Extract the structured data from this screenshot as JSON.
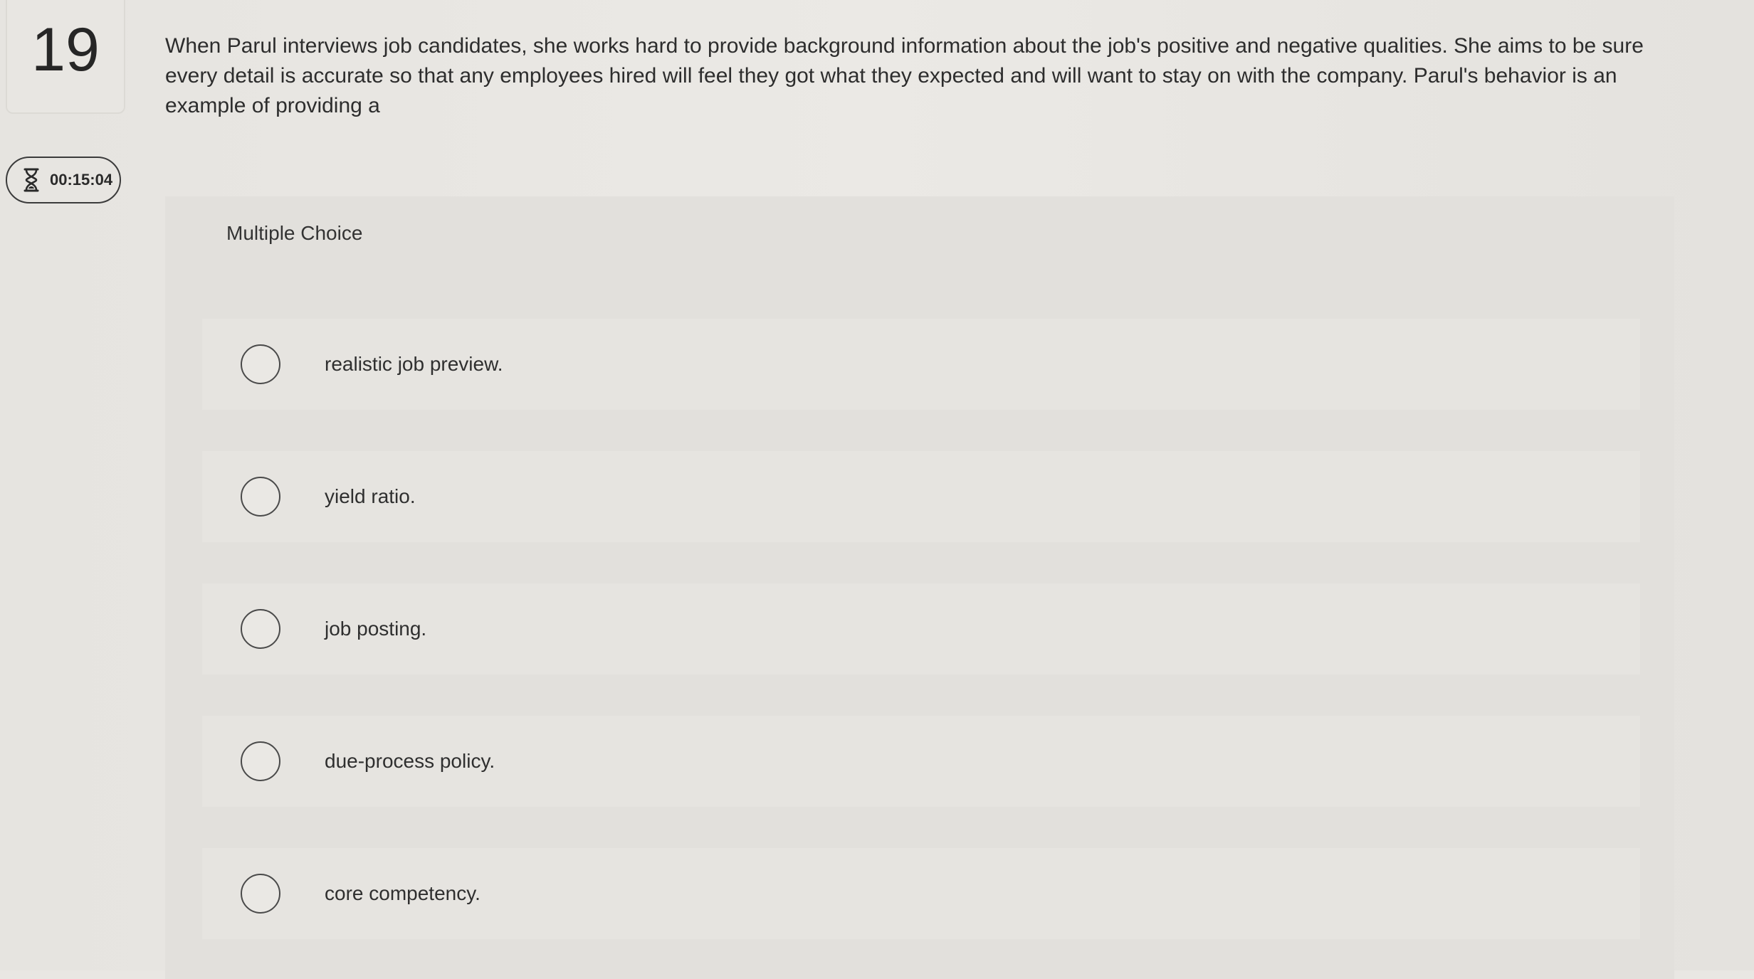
{
  "question": {
    "number": "19",
    "text": "When Parul interviews job candidates, she works hard to provide background information about the job's positive and negative qualities. She aims to be sure every detail is accurate so that any employees hired will feel they got what they expected and will want to stay on with the company. Parul's behavior is an example of providing a"
  },
  "timer": {
    "icon": "hourglass-icon",
    "value": "00:15:04"
  },
  "answers": {
    "type_label": "Multiple Choice",
    "options": [
      {
        "label": "realistic job preview."
      },
      {
        "label": "yield ratio."
      },
      {
        "label": "job posting."
      },
      {
        "label": "due-process policy."
      },
      {
        "label": "core competency."
      }
    ]
  }
}
